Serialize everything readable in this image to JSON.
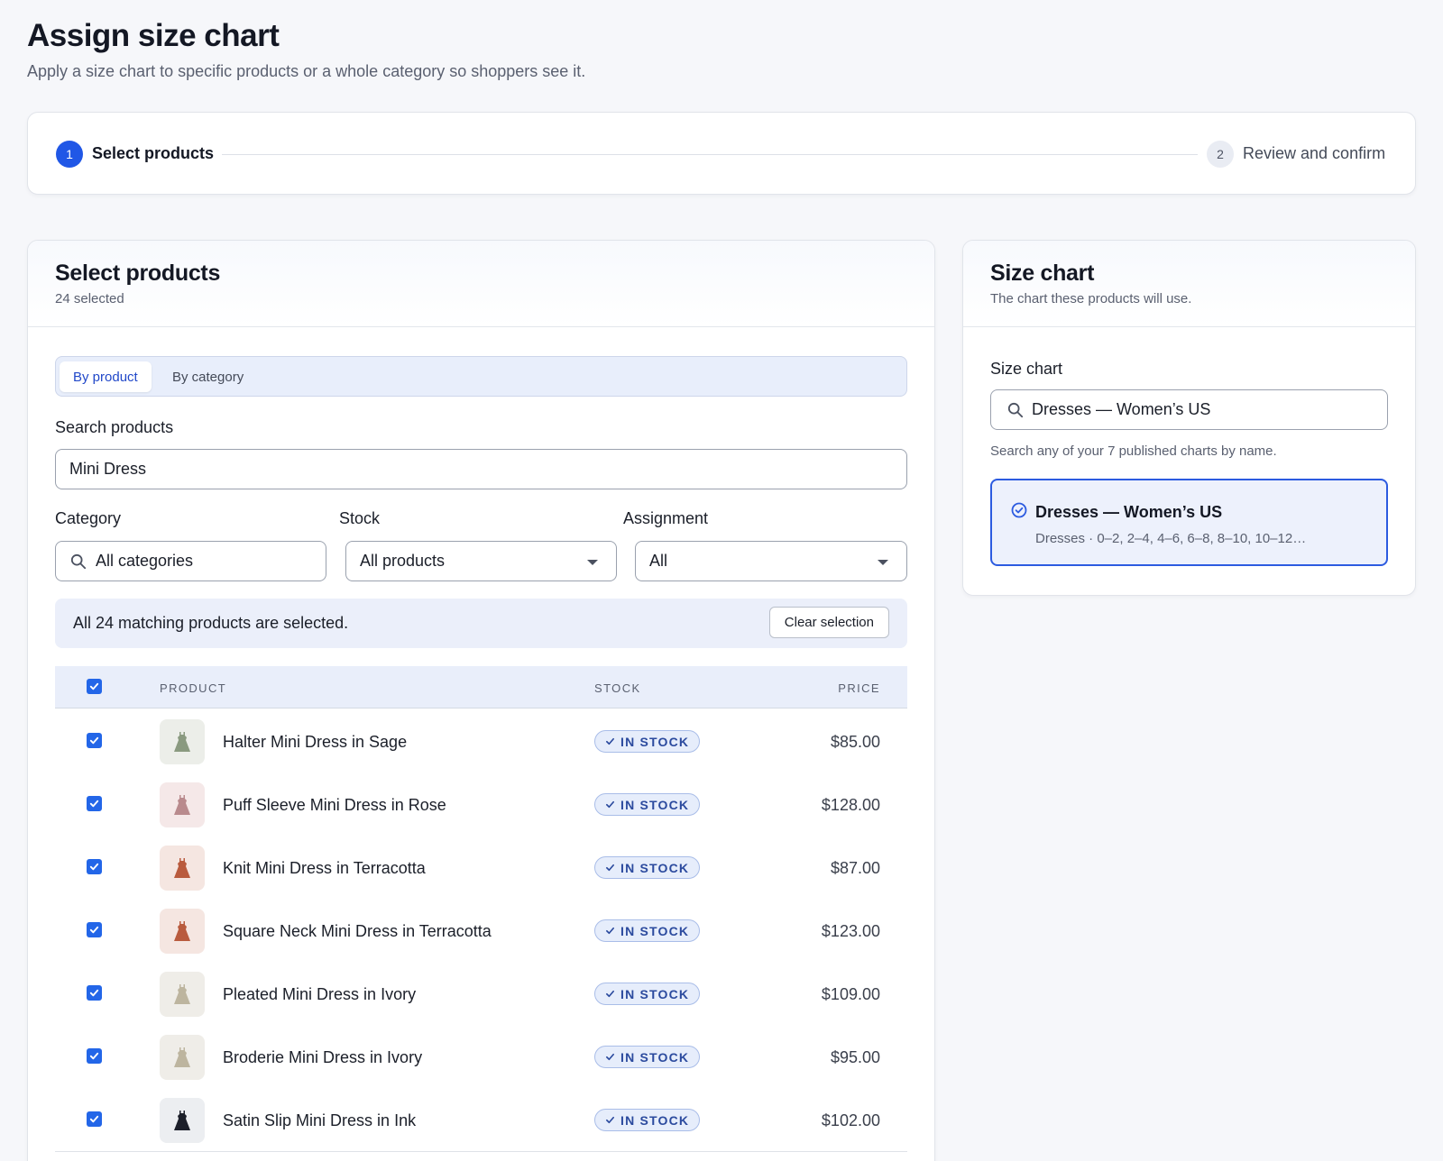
{
  "page": {
    "title": "Assign size chart",
    "subtitle": "Apply a size chart to specific products or a whole category so shoppers see it."
  },
  "stepper": {
    "steps": [
      {
        "number": "1",
        "label": "Select products",
        "active": true
      },
      {
        "number": "2",
        "label": "Review and confirm",
        "active": false
      }
    ]
  },
  "products_card": {
    "title": "Select products",
    "selected_count": "24 selected",
    "tabs": [
      {
        "label": "By product",
        "active": true
      },
      {
        "label": "By category",
        "active": false
      }
    ],
    "search": {
      "label": "Search products",
      "value": "Mini Dress"
    },
    "filters": {
      "category": {
        "label": "Category",
        "value": "All categories"
      },
      "stock": {
        "label": "Stock",
        "value": "All products"
      },
      "assignment": {
        "label": "Assignment",
        "value": "All"
      }
    },
    "banner": {
      "text": "All 24 matching products are selected.",
      "clear_label": "Clear selection"
    },
    "table": {
      "columns": {
        "product": "PRODUCT",
        "stock": "STOCK",
        "price": "PRICE"
      },
      "rows": [
        {
          "name": "Halter Mini Dress in Sage",
          "stock": "IN STOCK",
          "price": "$85.00",
          "swatch": "#8a9a80",
          "thumb_bg": "#eceee9"
        },
        {
          "name": "Puff Sleeve Mini Dress in Rose",
          "stock": "IN STOCK",
          "price": "$128.00",
          "swatch": "#b98a8d",
          "thumb_bg": "#f5e8e8"
        },
        {
          "name": "Knit Mini Dress in Terracotta",
          "stock": "IN STOCK",
          "price": "$87.00",
          "swatch": "#b95b3e",
          "thumb_bg": "#f5e6e1"
        },
        {
          "name": "Square Neck Mini Dress in Terracotta",
          "stock": "IN STOCK",
          "price": "$123.00",
          "swatch": "#b95b3e",
          "thumb_bg": "#f5e6e1"
        },
        {
          "name": "Pleated Mini Dress in Ivory",
          "stock": "IN STOCK",
          "price": "$109.00",
          "swatch": "#bdb59f",
          "thumb_bg": "#efede8"
        },
        {
          "name": "Broderie Mini Dress in Ivory",
          "stock": "IN STOCK",
          "price": "$95.00",
          "swatch": "#bdb59f",
          "thumb_bg": "#efede8"
        },
        {
          "name": "Satin Slip Mini Dress in Ink",
          "stock": "IN STOCK",
          "price": "$102.00",
          "swatch": "#1c1f2a",
          "thumb_bg": "#eceef1"
        }
      ]
    }
  },
  "size_chart_card": {
    "title": "Size chart",
    "subtitle": "The chart these products will use.",
    "field_label": "Size chart",
    "search_value": "Dresses — Women’s US",
    "help_text": "Search any of your 7 published charts by name.",
    "selected_option": {
      "title": "Dresses — Women’s US",
      "detail": "Dresses · 0–2, 2–4, 4–6, 6–8, 8–10, 10–12…"
    }
  },
  "colors": {
    "accent": "#2057e6",
    "checkbox": "#2366e8",
    "badge_text": "#2b4a9e"
  },
  "icons": [
    "search-icon",
    "caret-down-icon",
    "checkbox-check-icon",
    "dress-icon",
    "check-circle-icon"
  ]
}
